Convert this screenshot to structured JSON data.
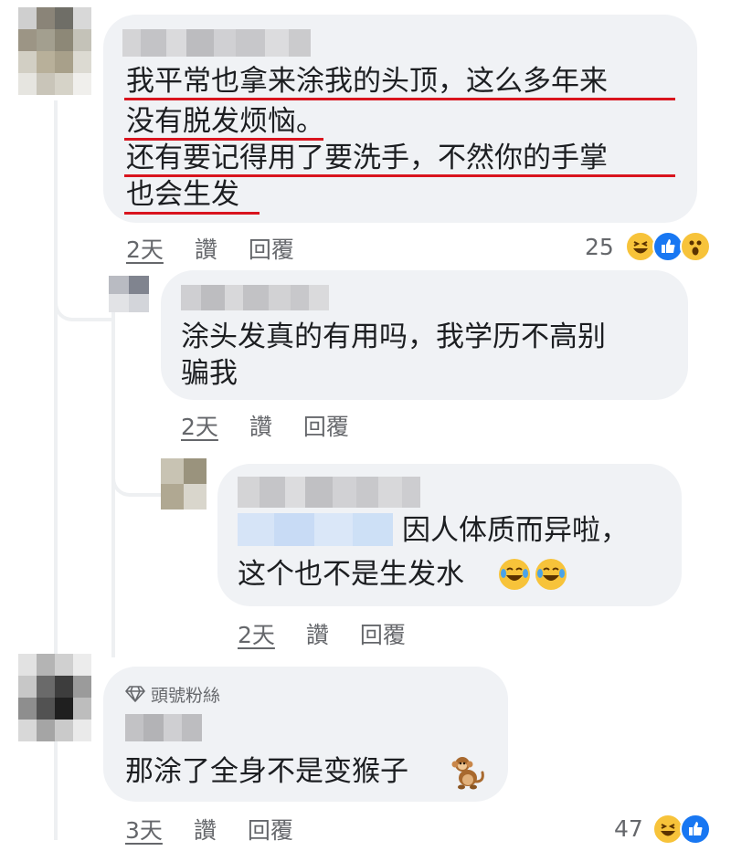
{
  "comments": [
    {
      "text_lines": [
        "我平常也拿来涂我的头顶，这么多年来",
        "没有脱发烦恼。",
        "还有要记得用了要洗手，不然你的手掌",
        "也会生发"
      ],
      "time": "2天",
      "like": "讚",
      "reply": "回覆",
      "reactions_count": "25",
      "reaction_icons": [
        "laughing-emoji-icon",
        "like-thumb-icon",
        "wow-emoji-icon"
      ]
    },
    {
      "text_lines": [
        "涂头发真的有用吗，我学历不高别",
        "骗我"
      ],
      "time": "2天",
      "like": "讚",
      "reply": "回覆"
    },
    {
      "text_lines": [
        "因人体质而异啦，",
        "这个也不是生发水"
      ],
      "time": "2天",
      "like": "讚",
      "reply": "回覆",
      "inline_icons": [
        "tears-of-joy-icon",
        "tears-of-joy-icon"
      ]
    },
    {
      "badge": "頭號粉絲",
      "text_lines": [
        "那涂了全身不是变猴子"
      ],
      "time": "3天",
      "like": "讚",
      "reply": "回覆",
      "reactions_count": "47",
      "reaction_icons": [
        "laughing-emoji-icon",
        "like-thumb-icon"
      ],
      "inline_icons": [
        "monkey-icon"
      ]
    }
  ],
  "colors": {
    "bubble": "#f0f2f5",
    "underline": "#d9141e",
    "meta_text": "#65676b",
    "like_blue": "#1877f2",
    "emoji_yellow": "#f7c33a"
  }
}
